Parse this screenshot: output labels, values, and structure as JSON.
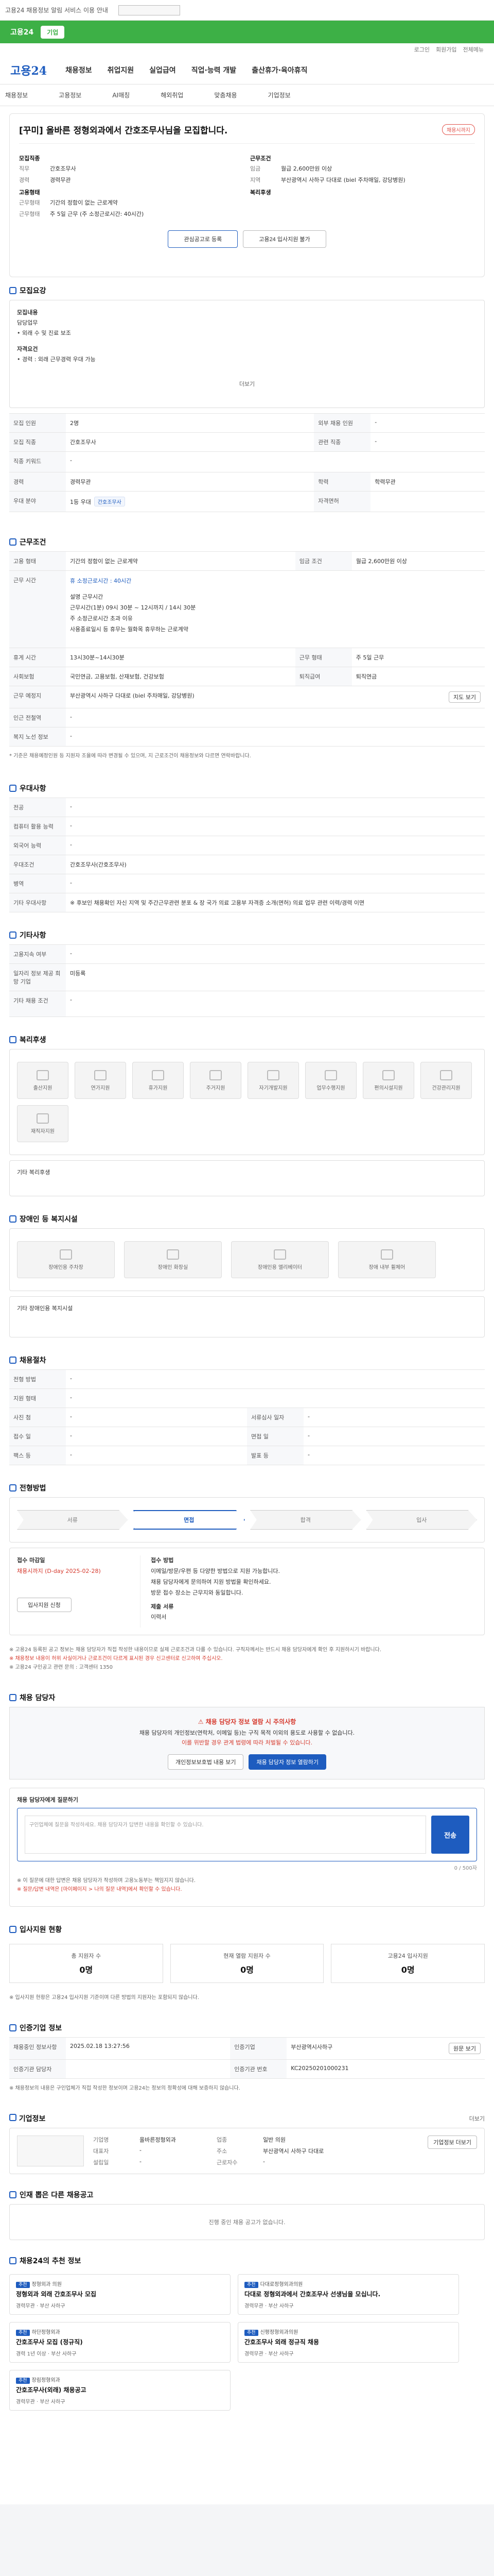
{
  "topbar": {
    "text": "고용24 채용정보 알림 서비스 이용 안내"
  },
  "banner": {
    "text": "고용24",
    "chip": "기업"
  },
  "util": [
    "로그인",
    "회원가입",
    "전체메뉴"
  ],
  "header": {
    "logo": "고용24",
    "nav": [
      "채용정보",
      "취업지원",
      "실업급여",
      "직업·능력 개발",
      "출산휴가·육아휴직"
    ]
  },
  "subnav": [
    "채용정보",
    "고용정보",
    "AI매칭",
    "해외취업",
    "맞춤채용",
    "기업정보"
  ],
  "job": {
    "title": "[꾸미] 올바른 정형외과에서 간호조무사님을 모집합니다.",
    "badge": "채용시까지",
    "left": {
      "head": "모집직종",
      "rows": [
        [
          "직무",
          "간호조무사"
        ],
        [
          "경력",
          "경력무관"
        ]
      ]
    },
    "right": {
      "head": "근무조건",
      "rows": [
        [
          "임금",
          "월급 2,600만원 이상"
        ],
        [
          "지역",
          "부산광역시 사하구 다대로 (biel 주차매일, 강당병원)"
        ]
      ]
    },
    "extra": {
      "head": "고용형태",
      "rows": [
        [
          "근무형태",
          "기간의 정함이 없는 근로계약"
        ],
        [
          "근무형태",
          "주 5일 근무 (주 소정근로시간: 40시간)"
        ]
      ]
    },
    "extra2": {
      "head": "복리후생"
    },
    "btn1": "관심공고로 등록",
    "btn2": "고용24 입사지원 불가"
  },
  "s1": {
    "title": "모집요강",
    "role_lbl": "모집내용",
    "role_v": "담당업무",
    "role_d": "• 외래 수 및 진료 보조",
    "ext_lbl": "자격요건",
    "ext_d": "• 경력 : 외래 근무경력 우대 가능",
    "more": "더보기",
    "rows": [
      [
        "모집 인원",
        "2명",
        "외부 채용 인원",
        "-"
      ],
      [
        "모집 직종",
        "간호조무사",
        "관련 직종",
        "-"
      ],
      [
        "직종 키워드",
        "-",
        "",
        ""
      ],
      [
        "경력",
        "경력무관",
        "학력",
        "학력무관"
      ],
      [
        "우대 분야",
        "1등 우대",
        "자격면허",
        "간호조무사"
      ]
    ]
  },
  "s2": {
    "title": "근무조건",
    "rows": [
      [
        "고용 형태",
        "기간의 정함이 없는 근로계약",
        "임금 조건",
        "월급 2,600만원 이상"
      ],
      [
        "근무 시간",
        "주 소정근로시간: 40시간",
        "",
        ""
      ],
      [
        "휴게 시간",
        "13시30분~14시30분",
        "근무 형태",
        "주 5일 근무"
      ],
      [
        "사회보험",
        "국민연금, 고용보험, 산재보험, 건강보험",
        "퇴직급여",
        "퇴직연금"
      ],
      [
        "근무 예정지",
        "부산광역시 사하구 다대로 (biel 주차매일, 강당병원)",
        "",
        ""
      ],
      [
        "인근 전철역",
        "-",
        "",
        ""
      ],
      [
        "복지 노선 정보",
        "-",
        "",
        ""
      ]
    ],
    "time_a": "휴 소정근로시간 : 40시간",
    "time_b": "설명 근무시간",
    "time_c": "근무시간(1분) 09시 30분 ~ 12시까지 / 14시 30분",
    "time_d": "주 소정근로시간 초과 이유",
    "time_e": "사용종료일시 등 휴무는 월화목 휴무하는 근로계약",
    "map": "지도 보기",
    "note": "* 기준은 채용예정인원 등 지원자 조율에 따라 변경될 수 있으며, 지 근로조건이 채용정보와 다르면 연락바랍니다."
  },
  "s3": {
    "title": "우대사항",
    "rows": [
      [
        "전공",
        "-"
      ],
      [
        "컴퓨터 활용 능력",
        "-"
      ],
      [
        "외국어 능력",
        "-"
      ],
      [
        "우대조건",
        "-"
      ],
      [
        "병역",
        "-"
      ],
      [
        "기타 우대사항",
        "-"
      ]
    ],
    "v4": "간호조무사(간호조무사)",
    "v6": "※ 후보인 채용확인 자신 지역 및 주간근무관련 분포 & 장 국가 의료 고용부 자격증 소개(면허) 의료 업무 관련 이력/경력 이면"
  },
  "s4": {
    "title": "기타사항",
    "rows": [
      [
        "고용지속 여부",
        "-"
      ],
      [
        "일자리 정보 제공 희망 기업",
        "미등록"
      ],
      [
        "기타 채용 조건",
        "-"
      ]
    ]
  },
  "s5": {
    "title": "복리후생",
    "tiles": [
      "출산지원",
      "연가지원",
      "휴가지원",
      "주거지원",
      "자기개발지원",
      "업무수행지원",
      "편의시설지원",
      "건강관리지원",
      "재직자지원"
    ],
    "sub": "기타 복리후생"
  },
  "s6": {
    "title": "장애인 등 복지시설",
    "tiles": [
      "장애인용 주차장",
      "장애인 화장실",
      "장애인용 엘리베이터",
      "장애 내부 휠체어"
    ],
    "sub": "기타 장애인용 복지시설"
  },
  "s7": {
    "title": "채용절차",
    "rows": [
      [
        "전형 방법",
        "-",
        "",
        ""
      ],
      [
        "지원 형태",
        "-",
        "",
        ""
      ],
      [
        "사진 첨",
        "-",
        "서류심사 일자",
        "-"
      ],
      [
        "접수 일",
        "-",
        "면접 일",
        "-"
      ],
      [
        "팩스 등",
        "-",
        "발표 등",
        "-"
      ]
    ]
  },
  "s8": {
    "title": "전형방법",
    "steps": [
      "서류",
      "면접",
      "합격",
      "입사"
    ],
    "left_h": "접수 마감일",
    "left_v": "채용시까지 (D-day 2025-02-28)",
    "left_btn": "입사지원 신청",
    "right_h": "접수 방법",
    "right_v": "이메일/방문/우편 등 다양한 방법으로 지원 가능합니다.",
    "right_v2": "채용 담당자에게 문의하여 지원 방법을 확인하세요.",
    "right_v3": "방문 접수 장소는 근무지와 동일합니다.",
    "right_h2": "제출 서류",
    "right_v4": "이력서",
    "notice": "※ 고용24 등록된 공고 정보는 채용 담당자가 직접 작성한 내용이므로 실제 근로조건과 다를 수 있습니다. 구직자께서는 반드시 채용 담당자에게 확인 후 지원하시기 바랍니다.",
    "notice2": "※ 채용정보 내용이 허위 사실이거나 근로조건이 다르게 표시된 경우 신고센터로 신고하여 주십시오.",
    "notice3": "※ 고용24 구인공고 관련 문의 : 고객센터 1350"
  },
  "s9": {
    "title": "채용 담당자",
    "alert_h": "채용 담당자 정보 열람 시 주의사항",
    "alert_1": "채용 담당자의 개인정보(연락처, 이메일 등)는 구직 목적 이외의 용도로 사용할 수 없습니다.",
    "alert_2": "이를 위반할 경우 관계 법령에 따라 처벌될 수 있습니다.",
    "b1": "개인정보보호법 내용 보기",
    "b2": "채용 담당자 정보 열람하기"
  },
  "s10": {
    "title": "채용 담당자에게 질문하기",
    "ph": "구인업체에 질문을 작성하세요. 채용 담당자가 답변한 내용을 확인할 수 있습니다.",
    "go": "전송",
    "note1": "※ 이 질문에 대한 답변은 채용 담당자가 작성하며 고용노동부는 책임지지 않습니다.",
    "note2": "※ 질문/답변 내역은 [마이페이지 > 나의 질문 내역]에서 확인할 수 있습니다.",
    "cnt": "0 / 500자"
  },
  "s11": {
    "title": "입사지원 현황",
    "stats": [
      [
        "총 지원자 수",
        "0명"
      ],
      [
        "현재 열람 지원자 수",
        "0명"
      ],
      [
        "고용24 입사지원",
        "0명"
      ]
    ],
    "note": "※ 입사지원 현황은 고용24 입사지원 기준이며 다른 방법의 지원자는 포함되지 않습니다."
  },
  "s12": {
    "title": "인증기업 정보",
    "rows": [
      [
        "채용중인 정보사항",
        "2025.02.18 13:27:56",
        "인증기업",
        "부산광역시사하구",
        "원문 보기"
      ],
      [
        "인증기관 담당자",
        "",
        "인증기관 번호",
        "KC20250201000231"
      ]
    ],
    "note": "※ 채용정보의 내용은 구인업체가 직접 작성한 정보이며 고용24는 정보의 정확성에 대해 보증하지 않습니다."
  },
  "s13": {
    "title": "기업정보",
    "more": "더보기",
    "rows": [
      [
        "기업명",
        "올바른정형외과",
        "업종",
        "일반 의원"
      ],
      [
        "대표자",
        "-",
        "주소",
        "부산광역시 사하구 다대로"
      ],
      [
        "설립일",
        "-",
        "근로자수",
        "-"
      ]
    ],
    "btn": "기업정보 더보기"
  },
  "s14": {
    "title": "인재 뽑은 다른 채용공고",
    "empty": "진행 중인 채용 공고가 없습니다."
  },
  "s15": {
    "title": "채용24의 추천 정보",
    "jobs": [
      {
        "co": "정형외과 의원",
        "t": "정형외과 외래 간호조무사 모집",
        "m": "경력무관 · 부산 사하구",
        "lbl": "추천"
      },
      {
        "co": "다대로정형외과의원",
        "t": "다대로 정형외과에서 간호조무사 선생님을 모십니다.",
        "m": "경력무관 · 부산 사하구",
        "lbl": "추천"
      },
      {
        "co": "하단정형외과",
        "t": "간호조무사 모집 (정규직)",
        "m": "경력 1년 이상 · 부산 사하구",
        "lbl": "추천"
      },
      {
        "co": "신평정형외과의원",
        "t": "간호조무사 외래 정규직 채용",
        "m": "경력무관 · 부산 사하구",
        "lbl": "추천"
      },
      {
        "co": "장림정형외과",
        "t": "간호조무사(외래) 채용공고",
        "m": "경력무관 · 부산 사하구",
        "lbl": "추천"
      }
    ]
  }
}
